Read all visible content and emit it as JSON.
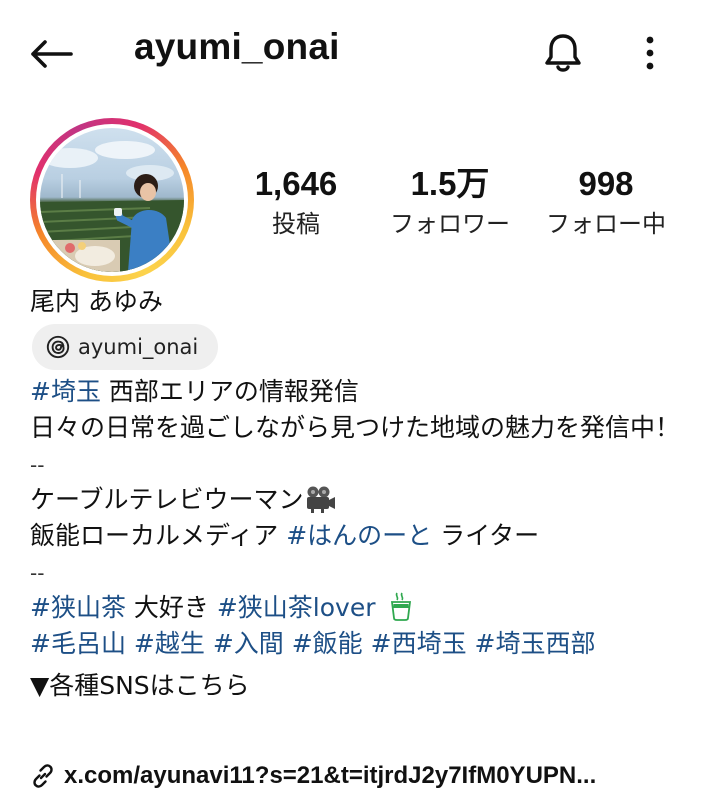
{
  "header": {
    "username": "ayumi_onai",
    "back_icon": "arrow-left-icon",
    "bell_icon": "bell-icon",
    "more_icon": "more-vertical-icon"
  },
  "stats": [
    {
      "value": "1,646",
      "label": "投稿"
    },
    {
      "value": "1.5万",
      "label": "フォロワー"
    },
    {
      "value": "998",
      "label": "フォロー中"
    }
  ],
  "profile": {
    "full_name": "尾内 あゆみ",
    "threads_handle": "ayumi_onai",
    "story_ring_colors": [
      "#f9c13a",
      "#f58529",
      "#e1306c",
      "#c13584"
    ]
  },
  "bio": {
    "line1_tag": "#埼玉",
    "line1_text": " 西部エリアの情報発信",
    "line2": "日々の日常を過ごしながら見つけた地域の魅力を発信中！",
    "sep1": "--",
    "line3": "ケーブルテレビウーマン",
    "line4_pre": "飯能ローカルメディア ",
    "line4_tag": "#はんのーと",
    "line4_post": " ライター",
    "sep2": "--",
    "line5_tag1": "#狭山茶",
    "line5_mid": " 大好き ",
    "line5_tag2": "#狭山茶lover",
    "line6_tags": [
      "#毛呂山",
      "#越生",
      "#入間",
      "#飯能",
      "#西埼玉",
      "#埼玉西部"
    ],
    "line7": "▼各種SNSはこちら"
  },
  "link": {
    "text": "x.com/ayunavi11?s=21&t=itjrdJ2y7IfM0YUPN...",
    "icon": "link-icon"
  },
  "colors": {
    "hashtag": "#1d4f86",
    "chip_bg": "#efefef",
    "tea_green": "#2fa84f"
  }
}
